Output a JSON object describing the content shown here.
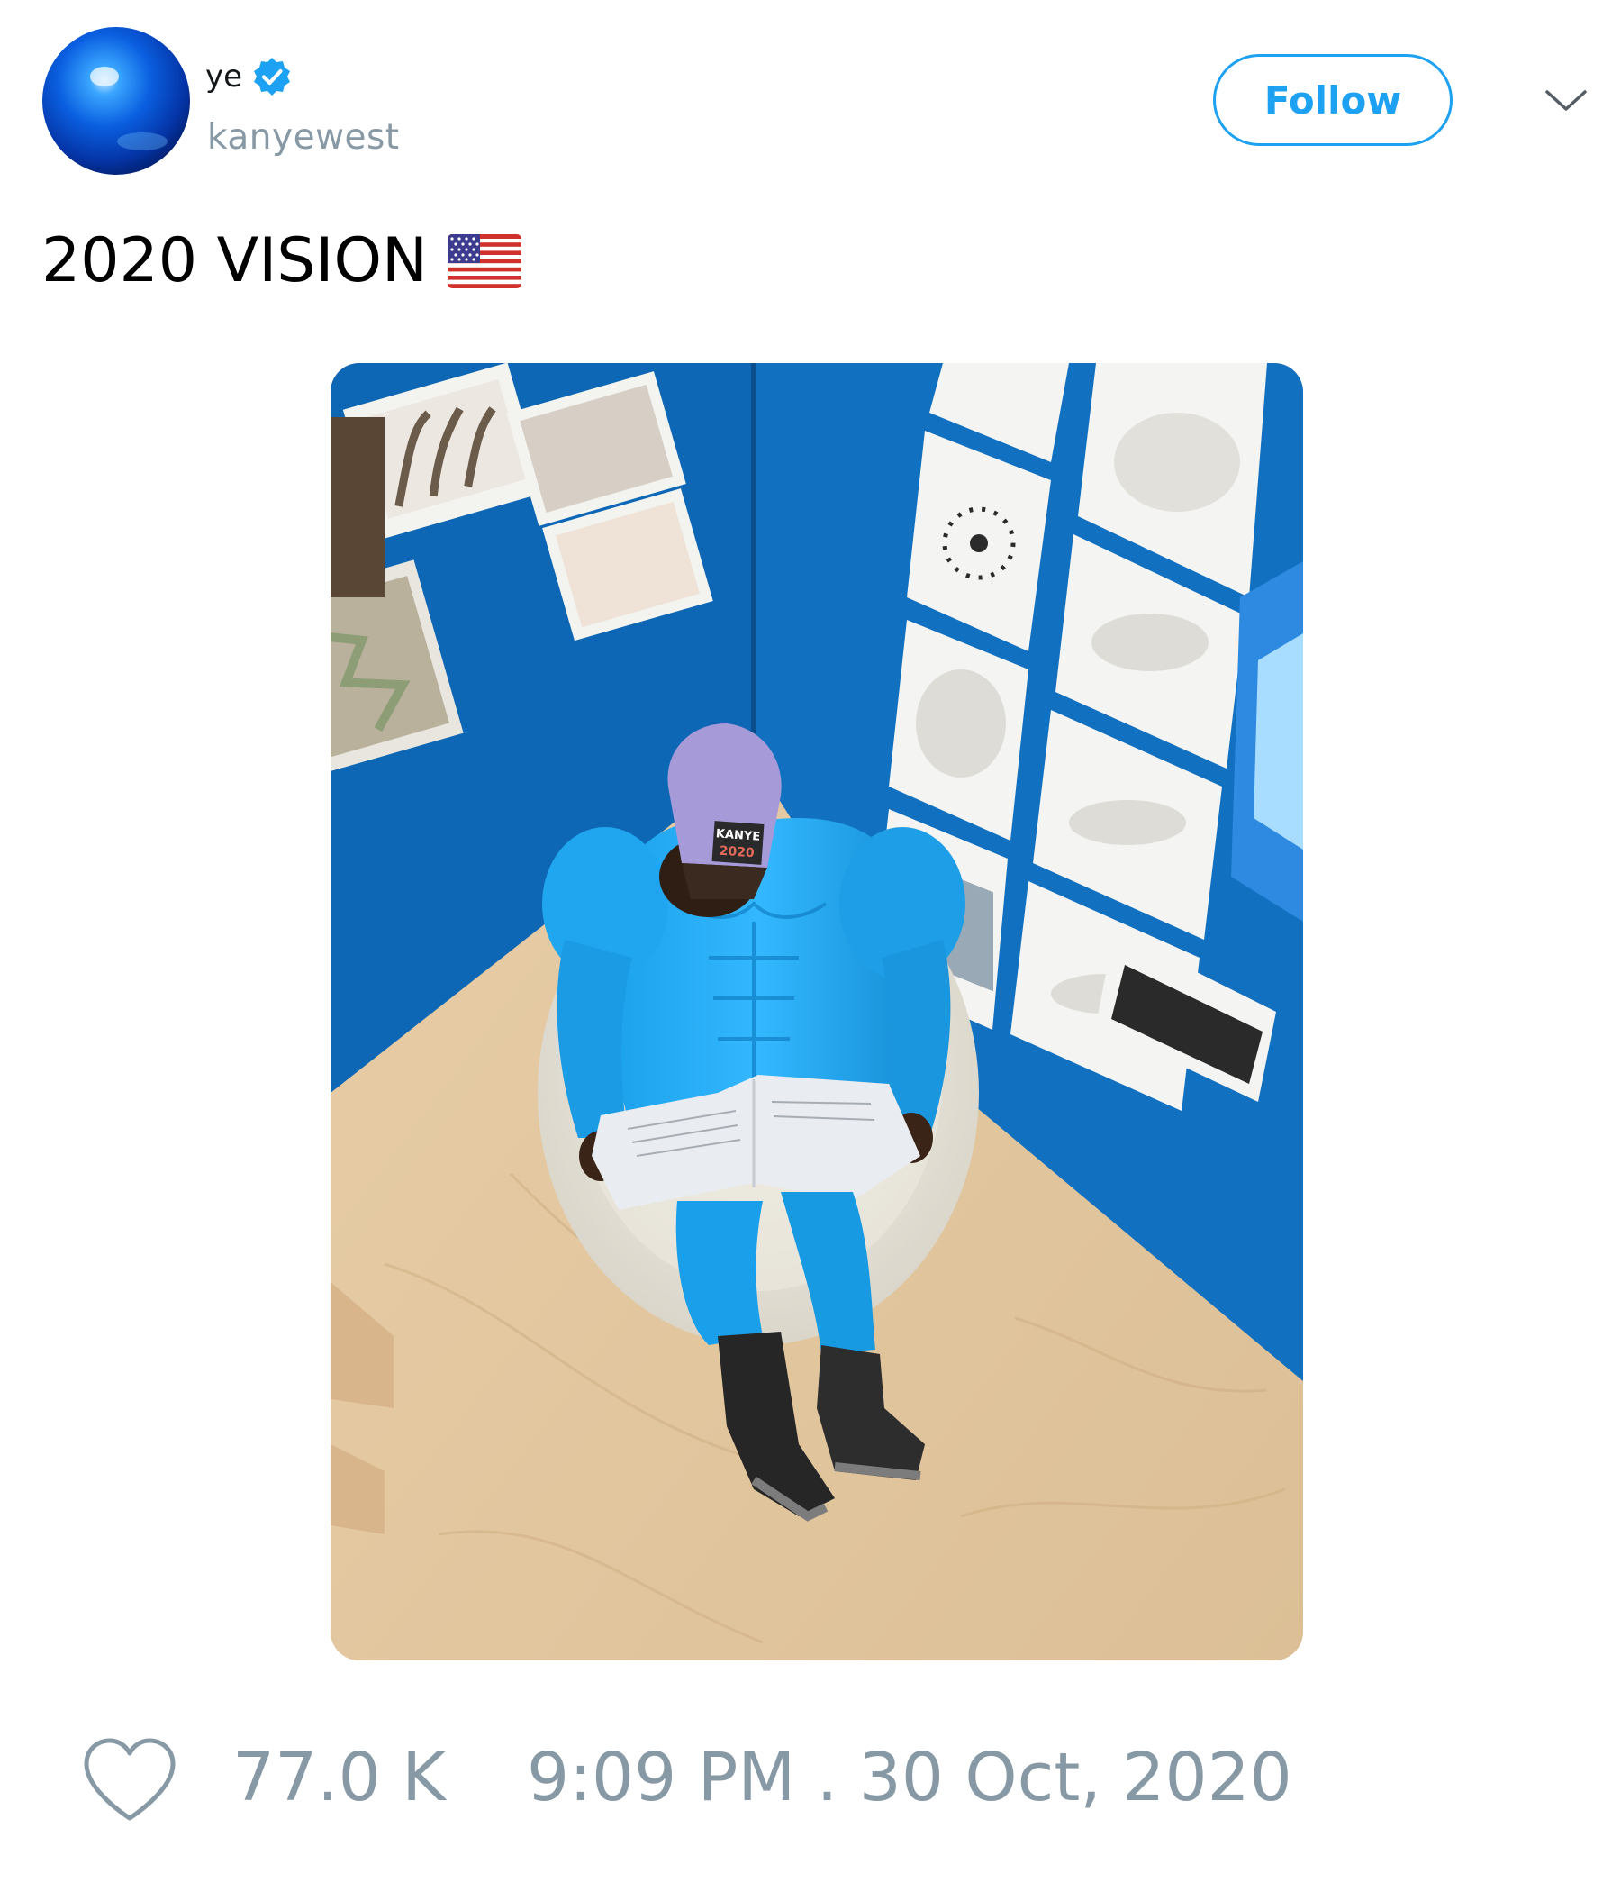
{
  "author": {
    "display_name": "ye",
    "handle": "kanyewest",
    "verified": true
  },
  "follow_label": "Follow",
  "tweet": {
    "text": "2020 VISION",
    "emoji": "us-flag-icon",
    "photo": {
      "cap_text": [
        "KANYE",
        "2020"
      ]
    }
  },
  "stats": {
    "likes": "77.0 K",
    "timestamp": "9:09 PM . 30 Oct, 2020"
  },
  "colors": {
    "accent": "#1da1f2",
    "muted": "#8899a6",
    "text": "#14171a"
  }
}
